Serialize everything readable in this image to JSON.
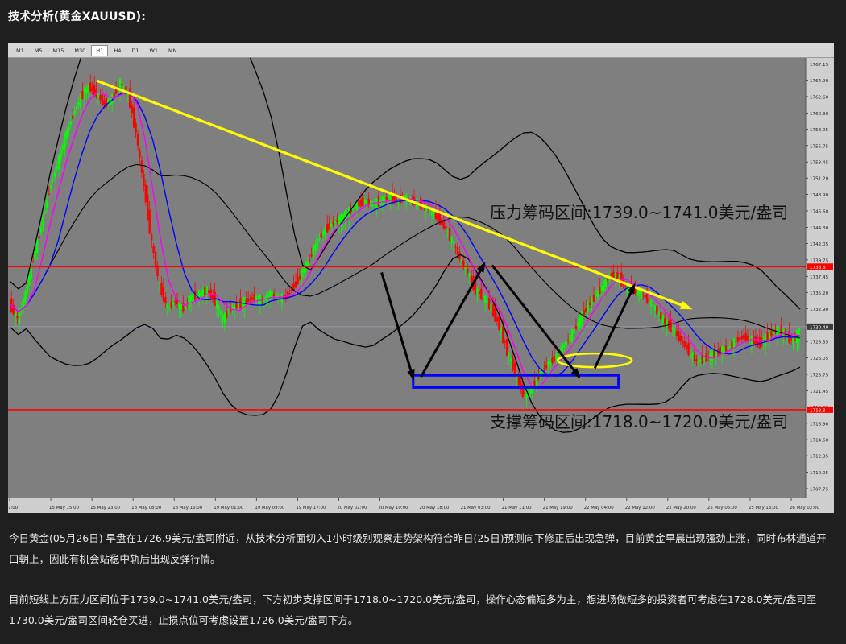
{
  "page": {
    "heading": "技术分析(黄金XAUUSD):",
    "paragraph1": "今日黄金(05月26日) 早盘在1726.9美元/盎司附近，从技术分析面切入1小时级别观察走势架构符合昨日(25日)预测向下修正后出现急弹，目前黄金早晨出现强劲上涨，同时布林通道开口朝上，因此有机会站稳中轨后出现反弹行情。",
    "paragraph2": "目前短线上方压力区间位于1739.0~1741.0美元/盎司，下方初步支撑区间于1718.0~1720.0美元/盎司，操作心态偏短多为主，想进场做短多的投资者可考虑在1728.0美元/盎司至1730.0美元/盎司区间轻仓买进，止损点位可考虑设置1726.0美元/盎司下方。"
  },
  "toolbar": {
    "timeframes": [
      "M1",
      "M5",
      "M15",
      "M30",
      "H1",
      "H4",
      "D1",
      "W1",
      "MN"
    ],
    "active": "H1"
  },
  "chart_data": {
    "type": "candlestick",
    "symbol": "XAUUSD",
    "timeframe": "H1",
    "ylim": [
      1706.4,
      1768.0
    ],
    "y_ticks": [
      "1767.15",
      "1764.90",
      "1762.60",
      "1760.30",
      "1758.05",
      "1755.75",
      "1753.45",
      "1751.20",
      "1748.90",
      "1746.60",
      "1744.30",
      "1742.05",
      "1739.75",
      "1737.45",
      "1735.20",
      "1732.90",
      "1730.60",
      "1728.35",
      "1726.05",
      "1723.75",
      "1721.45",
      "1719.20",
      "1716.90",
      "1714.60",
      "1712.35",
      "1710.05",
      "1707.75"
    ],
    "x_ticks": [
      "7:00",
      "15 May 15:00",
      "15 May 23:00",
      "18 May 08:00",
      "18 May 16:00",
      "19 May 01:00",
      "19 May 09:00",
      "19 May 17:00",
      "20 May 02:00",
      "20 May 10:00",
      "20 May 18:00",
      "21 May 03:00",
      "21 May 11:00",
      "21 May 19:00",
      "22 May 04:00",
      "22 May 12:00",
      "22 May 20:00",
      "25 May 05:00",
      "25 May 13:00",
      "26 May 02:00"
    ],
    "resistance_line": 1738.8,
    "resistance_label": "1738.8",
    "support_line": 1718.8,
    "support_label": "1718.8",
    "current_price": 1730.4,
    "current_price_label": "1730.40",
    "annotations": {
      "resistance_zone_text": "压力筹码区间:1739.0~1741.0美元/盎司",
      "support_zone_text": "支撑筹码区间:1718.0~1720.0美元/盎司"
    },
    "colors": {
      "background": "#7f7f7f",
      "bull_candle": "#00ff00",
      "bear_candle": "#ff0000",
      "bollinger": "#000000",
      "ma_fast": "#ff00ff",
      "ma_slow": "#0000ff",
      "trendline": "#ffff00",
      "levels": "#ff0000",
      "support_box": "#0000ff",
      "arrows": "#000000"
    },
    "closes": [
      1733.5,
      1731.5,
      1735.0,
      1740.0,
      1744.5,
      1749.5,
      1753.0,
      1757.0,
      1760.0,
      1762.5,
      1764.0,
      1763.0,
      1761.5,
      1762.5,
      1764.5,
      1763.0,
      1757.5,
      1750.0,
      1742.0,
      1736.0,
      1733.0,
      1734.0,
      1733.0,
      1734.5,
      1735.0,
      1735.5,
      1734.0,
      1731.5,
      1733.0,
      1733.5,
      1734.0,
      1734.5,
      1734.0,
      1735.0,
      1734.5,
      1734.5,
      1736.0,
      1738.0,
      1740.0,
      1742.5,
      1744.0,
      1745.0,
      1745.5,
      1746.5,
      1747.5,
      1748.0,
      1747.5,
      1748.0,
      1748.5,
      1748.0,
      1748.5,
      1748.0,
      1747.5,
      1747.0,
      1746.0,
      1744.5,
      1742.5,
      1740.0,
      1738.0,
      1735.5,
      1734.5,
      1733.0,
      1730.5,
      1727.0,
      1724.0,
      1721.0,
      1721.5,
      1723.5,
      1725.0,
      1726.0,
      1727.5,
      1729.0,
      1731.0,
      1733.0,
      1734.5,
      1736.0,
      1737.5,
      1737.5,
      1736.0,
      1735.5,
      1735.0,
      1734.0,
      1732.5,
      1731.0,
      1730.0,
      1728.5,
      1727.0,
      1725.5,
      1726.0,
      1726.5,
      1727.0,
      1727.5,
      1728.5,
      1729.0,
      1728.5,
      1728.0,
      1729.0,
      1730.0,
      1729.5,
      1728.5,
      1729.5
    ]
  }
}
